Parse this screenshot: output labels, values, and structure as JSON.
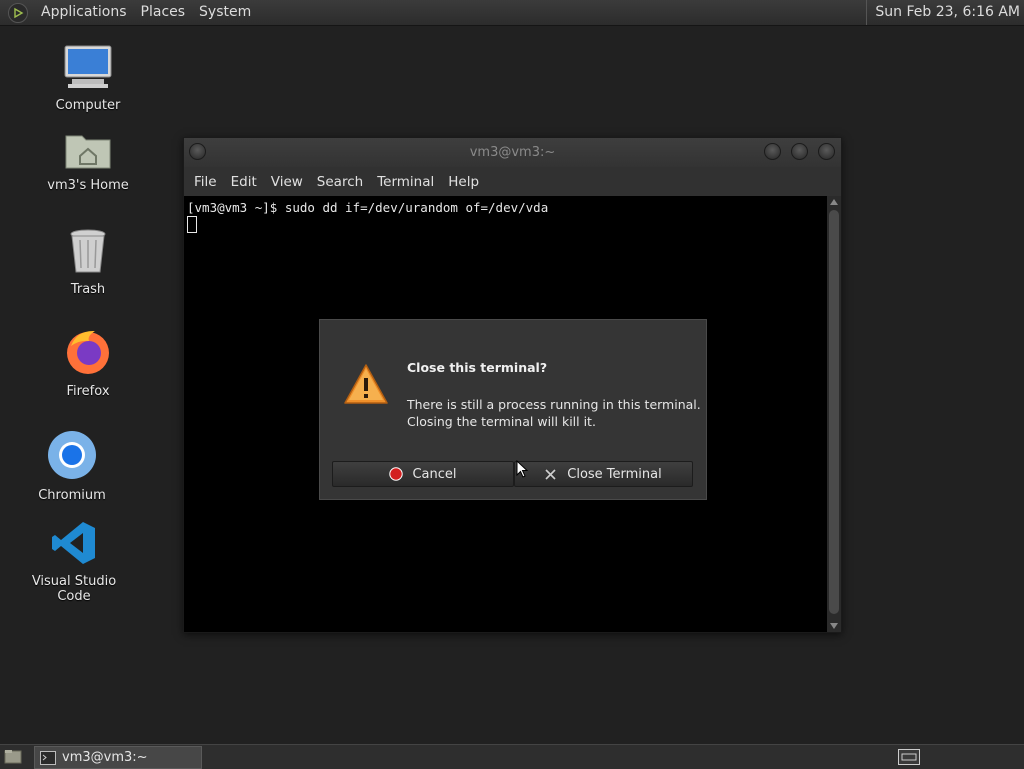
{
  "topbar": {
    "menu": [
      "Applications",
      "Places",
      "System"
    ],
    "clock": "Sun Feb 23,  6:16 AM"
  },
  "desktop": {
    "icons": [
      {
        "label": "Computer",
        "icon": "computer-icon"
      },
      {
        "label": "vm3's Home",
        "icon": "home-folder-icon"
      },
      {
        "label": "Trash",
        "icon": "trash-icon"
      },
      {
        "label": "Firefox",
        "icon": "firefox-icon"
      },
      {
        "label": "Chromium",
        "icon": "chromium-icon"
      },
      {
        "label": "Visual Studio Code",
        "icon": "vscode-icon"
      }
    ]
  },
  "terminal_window": {
    "title": "vm3@vm3:~",
    "menu": [
      "File",
      "Edit",
      "View",
      "Search",
      "Terminal",
      "Help"
    ],
    "prompt_line": "[vm3@vm3 ~]$ sudo dd if=/dev/urandom of=/dev/vda"
  },
  "dialog": {
    "icon": "warning-icon",
    "title": "Close this terminal?",
    "message_line1": "There is still a process running in this terminal.",
    "message_line2": "Closing the terminal will kill it.",
    "cancel_label": "Cancel",
    "close_label": "Close Terminal"
  },
  "taskbar": {
    "task_label": "vm3@vm3:~"
  },
  "colors": {
    "desktop_bg": "#212121",
    "terminal_bg": "#000000",
    "warning_orange": "#f0902a",
    "cancel_red": "#d31f1f",
    "vscode_blue": "#1f8ad2"
  }
}
